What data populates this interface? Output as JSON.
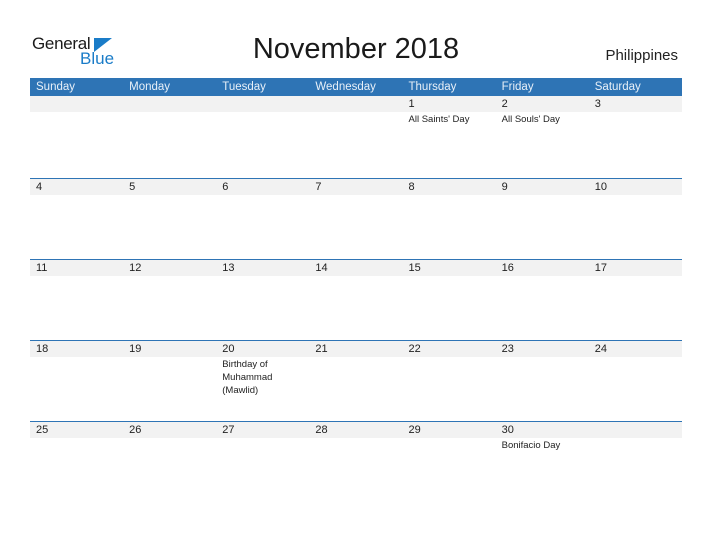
{
  "logo": {
    "line1": "General",
    "line2": "Blue"
  },
  "title": "November 2018",
  "country": "Philippines",
  "colors": {
    "header_bg": "#2e74b5",
    "date_strip": "#f2f2f2",
    "brand_blue": "#1a7cc8"
  },
  "days": [
    "Sunday",
    "Monday",
    "Tuesday",
    "Wednesday",
    "Thursday",
    "Friday",
    "Saturday"
  ],
  "weeks": [
    [
      {
        "d": "",
        "e": ""
      },
      {
        "d": "",
        "e": ""
      },
      {
        "d": "",
        "e": ""
      },
      {
        "d": "",
        "e": ""
      },
      {
        "d": "1",
        "e": "All Saints' Day"
      },
      {
        "d": "2",
        "e": "All Souls' Day"
      },
      {
        "d": "3",
        "e": ""
      }
    ],
    [
      {
        "d": "4",
        "e": ""
      },
      {
        "d": "5",
        "e": ""
      },
      {
        "d": "6",
        "e": ""
      },
      {
        "d": "7",
        "e": ""
      },
      {
        "d": "8",
        "e": ""
      },
      {
        "d": "9",
        "e": ""
      },
      {
        "d": "10",
        "e": ""
      }
    ],
    [
      {
        "d": "11",
        "e": ""
      },
      {
        "d": "12",
        "e": ""
      },
      {
        "d": "13",
        "e": ""
      },
      {
        "d": "14",
        "e": ""
      },
      {
        "d": "15",
        "e": ""
      },
      {
        "d": "16",
        "e": ""
      },
      {
        "d": "17",
        "e": ""
      }
    ],
    [
      {
        "d": "18",
        "e": ""
      },
      {
        "d": "19",
        "e": ""
      },
      {
        "d": "20",
        "e": "Birthday of Muhammad (Mawlid)"
      },
      {
        "d": "21",
        "e": ""
      },
      {
        "d": "22",
        "e": ""
      },
      {
        "d": "23",
        "e": ""
      },
      {
        "d": "24",
        "e": ""
      }
    ],
    [
      {
        "d": "25",
        "e": ""
      },
      {
        "d": "26",
        "e": ""
      },
      {
        "d": "27",
        "e": ""
      },
      {
        "d": "28",
        "e": ""
      },
      {
        "d": "29",
        "e": ""
      },
      {
        "d": "30",
        "e": "Bonifacio Day"
      },
      {
        "d": "",
        "e": ""
      }
    ]
  ]
}
